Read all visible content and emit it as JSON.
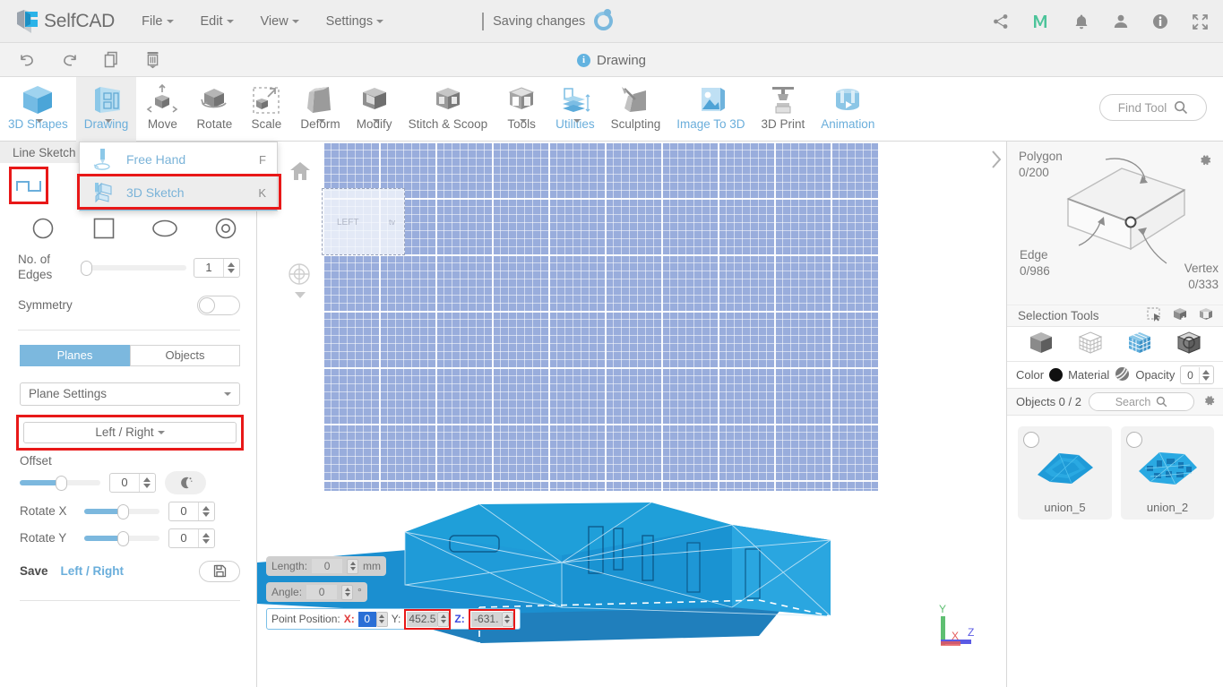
{
  "topbar": {
    "brand": "SelfCAD",
    "menus": [
      {
        "label": "File"
      },
      {
        "label": "Edit"
      },
      {
        "label": "View"
      },
      {
        "label": "Settings"
      }
    ],
    "status_text": "Saving changes",
    "icons": [
      {
        "name": "share-icon"
      },
      {
        "name": "medium-m-icon"
      },
      {
        "name": "bell-icon"
      },
      {
        "name": "user-icon"
      },
      {
        "name": "info-icon"
      },
      {
        "name": "fullscreen-icon"
      }
    ]
  },
  "secondbar": {
    "undo": "undo-icon",
    "redo": "redo-icon",
    "copy": "copy-icon",
    "delete": "trash-icon",
    "title": "Drawing"
  },
  "ribbon": {
    "items": [
      {
        "label": "3D Shapes",
        "caret": true,
        "blue": true,
        "active": false,
        "icon": "cube-blue-icon"
      },
      {
        "label": "Drawing",
        "caret": true,
        "blue": true,
        "active": true,
        "icon": "drawing-board-icon"
      },
      {
        "label": "Move",
        "caret": false,
        "blue": false,
        "active": false,
        "icon": "move-icon"
      },
      {
        "label": "Rotate",
        "caret": false,
        "blue": false,
        "active": false,
        "icon": "rotate-icon"
      },
      {
        "label": "Scale",
        "caret": false,
        "blue": false,
        "active": false,
        "icon": "scale-icon"
      },
      {
        "label": "Deform",
        "caret": true,
        "blue": false,
        "active": false,
        "icon": "deform-icon"
      },
      {
        "label": "Modify",
        "caret": true,
        "blue": false,
        "active": false,
        "icon": "modify-icon"
      },
      {
        "label": "Stitch & Scoop",
        "caret": false,
        "blue": false,
        "active": false,
        "icon": "stitch-scoop-icon"
      },
      {
        "label": "Tools",
        "caret": true,
        "blue": false,
        "active": false,
        "icon": "tools-icon"
      },
      {
        "label": "Utilities",
        "caret": true,
        "blue": true,
        "active": false,
        "icon": "utilities-icon"
      },
      {
        "label": "Sculpting",
        "caret": false,
        "blue": false,
        "active": false,
        "icon": "sculpting-icon"
      },
      {
        "label": "Image To 3D",
        "caret": false,
        "blue": true,
        "active": false,
        "icon": "image-to-3d-icon"
      },
      {
        "label": "3D Print",
        "caret": false,
        "blue": false,
        "active": false,
        "icon": "3d-print-icon"
      },
      {
        "label": "Animation",
        "caret": false,
        "blue": true,
        "active": false,
        "icon": "animation-icon"
      }
    ],
    "find_tool": "Find Tool"
  },
  "dropdown": {
    "items": [
      {
        "label": "Free Hand",
        "key": "F",
        "highlighted": false
      },
      {
        "label": "3D Sketch",
        "key": "K",
        "highlighted": true
      }
    ]
  },
  "leftpanel": {
    "header": "Line Sketch (",
    "shapes": [
      {
        "name": "polyline-shape",
        "selected": true
      },
      {
        "name": "circle-shape",
        "selected": false
      },
      {
        "name": "square-shape",
        "selected": false
      },
      {
        "name": "ellipse-shape",
        "selected": false
      },
      {
        "name": "ring-shape",
        "selected": false
      }
    ],
    "edges_label": "No. of Edges",
    "edges_value": "1",
    "symmetry_label": "Symmetry",
    "symmetry_on": false,
    "seg_planes": "Planes",
    "seg_objects": "Objects",
    "plane_settings": "Plane Settings",
    "plane_choice": "Left / Right",
    "offset_label": "Offset",
    "offset_value": "0",
    "rotate_x_label": "Rotate X",
    "rotate_x_value": "0",
    "rotate_y_label": "Rotate Y",
    "rotate_y_value": "0",
    "save_label": "Save",
    "save_target": "Left / Right"
  },
  "viewport": {
    "ghost_label_left": "LEFT",
    "ghost_label_right": "tv",
    "length_label": "Length:",
    "length_value": "0",
    "length_unit": "mm",
    "angle_label": "Angle:",
    "angle_value": "0",
    "angle_unit": "°",
    "point_position_label": "Point Position:",
    "x_label": "X:",
    "x_value": "0",
    "y_label": "Y:",
    "y_value": "452.5",
    "z_label": "Z:",
    "z_value": "-631.",
    "axes": {
      "x": "X",
      "y": "Y",
      "z": "Z",
      "x_color": "#e45a5a",
      "y_color": "#5fbf72",
      "z_color": "#5a5ae4"
    }
  },
  "rightpanel": {
    "polygon_label": "Polygon",
    "polygon_count": "0/200",
    "edge_label": "Edge",
    "edge_count": "0/986",
    "vertex_label": "Vertex",
    "vertex_count": "0/333",
    "selection_tools_label": "Selection Tools",
    "selection_tool_icons": [
      "marquee-select-icon",
      "box-add-select-icon",
      "box-sub-select-icon"
    ],
    "mode_icons": [
      "object-mode-icon",
      "vertex-mode-icon",
      "polygon-mode-icon",
      "edge-mode-icon"
    ],
    "color_label": "Color",
    "color_value": "#101010",
    "material_label": "Material",
    "opacity_label": "Opacity",
    "opacity_value": "0",
    "objects_label": "Objects 0 / 2",
    "search_placeholder": "Search",
    "objects": [
      {
        "name": "union_5"
      },
      {
        "name": "union_2"
      }
    ]
  },
  "colors": {
    "accent_blue": "#6aaedb",
    "highlight_red": "#e81818",
    "grid_blue": "#8ca2d8",
    "model_blue": "#1f9bd8"
  }
}
